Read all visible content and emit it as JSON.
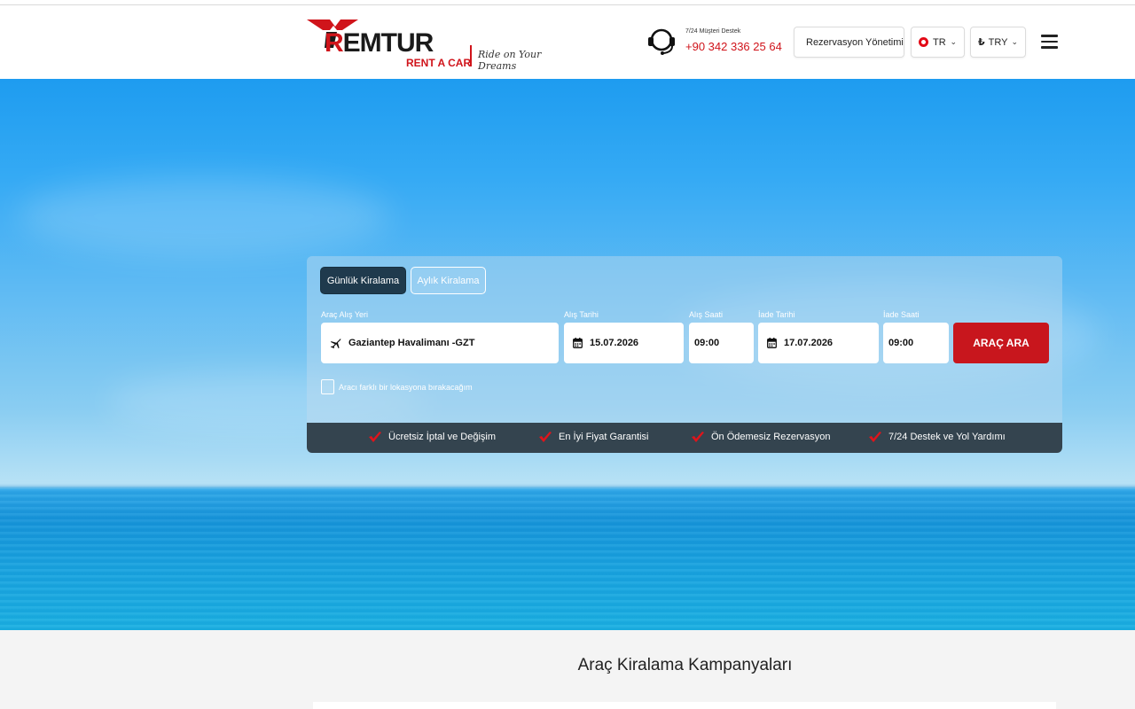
{
  "header": {
    "logo": {
      "name": "REMTUR",
      "r": "R",
      "rest": "EMTUR",
      "sub": "RENT A CAR",
      "slogan": "Ride on Your Dreams"
    },
    "support": {
      "label": "7/24 Müşteri Destek",
      "phone": "+90 342 336 25 64"
    },
    "reservation_button": "Rezervasyon Yönetimi",
    "language": "TR",
    "currency": "TRY",
    "currency_symbol": "₺"
  },
  "booking": {
    "tabs": [
      {
        "label": "Günlük Kiralama",
        "active": true
      },
      {
        "label": "Aylık Kiralama",
        "active": false
      }
    ],
    "pickup_location": {
      "label": "Araç Alış Yeri",
      "value": "Gaziantep Havalimanı -GZT"
    },
    "pickup_date": {
      "label": "Alış Tarihi",
      "value": "15.07.2026"
    },
    "pickup_time": {
      "label": "Alış Saati",
      "value": "09:00"
    },
    "return_date": {
      "label": "İade Tarihi",
      "value": "17.07.2026"
    },
    "return_time": {
      "label": "İade Saati",
      "value": "09:00"
    },
    "search_button": "ARAÇ ARA",
    "different_location_label": "Aracı farklı bir lokasyona bırakacağım",
    "different_location_checked": false
  },
  "features": [
    "Ücretsiz İptal ve Değişim",
    "En İyi Fiyat Garantisi",
    "Ön Ödemesiz Rezervasyon",
    "7/24 Destek ve Yol Yardımı"
  ],
  "campaigns": {
    "title": "Araç Kiralama Kampanyaları"
  },
  "colors": {
    "brand_red": "#d0141b",
    "button_red": "#c8161d",
    "dark_navy": "#1f3a4d",
    "feature_bar": "#34444f"
  }
}
